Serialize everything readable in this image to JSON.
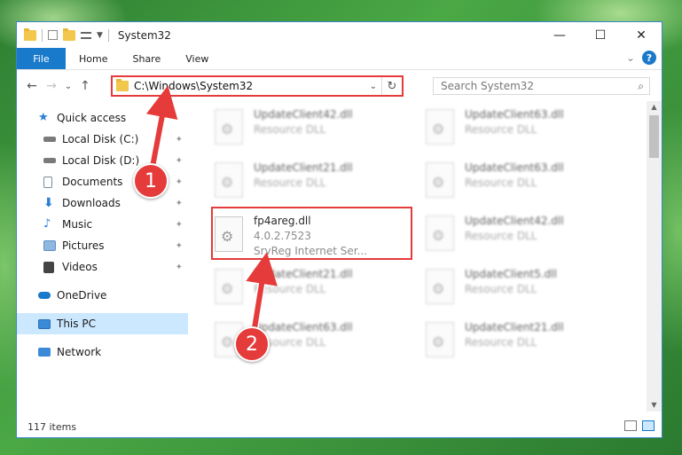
{
  "window": {
    "title": "System32",
    "controls": {
      "minimize": "—",
      "maximize": "☐",
      "close": "✕"
    }
  },
  "ribbon": {
    "tabs": [
      "File",
      "Home",
      "Share",
      "View"
    ],
    "expand_glyph": "⌄",
    "help_glyph": "?"
  },
  "nav": {
    "back": "←",
    "forward": "→",
    "recent": "⌄",
    "up": "↑",
    "address": "C:\\Windows\\System32",
    "address_dropdown": "⌄",
    "refresh": "↻",
    "search_placeholder": "Search System32",
    "search_glyph": "⌕"
  },
  "sidebar": {
    "items": [
      {
        "label": "Quick access",
        "icon": "star-icon",
        "color": "#2a7fd4",
        "pinned": false
      },
      {
        "label": "Local Disk (C:)",
        "icon": "drive-icon",
        "color": "#6a6a6a",
        "pinned": true
      },
      {
        "label": "Local Disk (D:)",
        "icon": "drive-icon",
        "color": "#6a6a6a",
        "pinned": true
      },
      {
        "label": "Documents",
        "icon": "documents-icon",
        "color": "#7a8aa0",
        "pinned": true
      },
      {
        "label": "Downloads",
        "icon": "downloads-icon",
        "color": "#2a7fd4",
        "pinned": true
      },
      {
        "label": "Music",
        "icon": "music-icon",
        "color": "#2a7fd4",
        "pinned": true
      },
      {
        "label": "Pictures",
        "icon": "pictures-icon",
        "color": "#5b8fbf",
        "pinned": true
      },
      {
        "label": "Videos",
        "icon": "videos-icon",
        "color": "#444",
        "pinned": true
      },
      {
        "label": "OneDrive",
        "icon": "onedrive-icon",
        "color": "#1979ca",
        "pinned": false
      },
      {
        "label": "This PC",
        "icon": "computer-icon",
        "color": "#3b8ad8",
        "pinned": false
      },
      {
        "label": "Network",
        "icon": "network-icon",
        "color": "#3b8ad8",
        "pinned": false
      }
    ],
    "pin_glyph": "📌"
  },
  "files": [
    {
      "name": "UpdateClient42.dll",
      "type": "Resource DLL",
      "blurred": true
    },
    {
      "name": "UpdateClient63.dll",
      "type": "Resource DLL",
      "blurred": true
    },
    {
      "name": "UpdateClient21.dll",
      "type": "Resource DLL",
      "blurred": true
    },
    {
      "name": "UpdateClient63.dll",
      "type": "Resource DLL",
      "blurred": true
    },
    {
      "name": "fp4areg.dll",
      "type": "4.0.2.7523",
      "extra": "SrvReg Internet Ser...",
      "blurred": false,
      "highlighted": true
    },
    {
      "name": "UpdateClient42.dll",
      "type": "Resource DLL",
      "blurred": true
    },
    {
      "name": "UpdateClient21.dll",
      "type": "Resource DLL",
      "blurred": true
    },
    {
      "name": "UpdateClient5.dll",
      "type": "Resource DLL",
      "blurred": true
    },
    {
      "name": "UpdateClient63.dll",
      "type": "Resource DLL",
      "blurred": true
    },
    {
      "name": "UpdateClient21.dll",
      "type": "Resource DLL",
      "blurred": true
    }
  ],
  "status": {
    "item_count": "117 items"
  },
  "callouts": [
    "1",
    "2"
  ],
  "colors": {
    "accent": "#1979ca",
    "annotation_red": "#e53b3b",
    "selection": "#cce8ff"
  }
}
